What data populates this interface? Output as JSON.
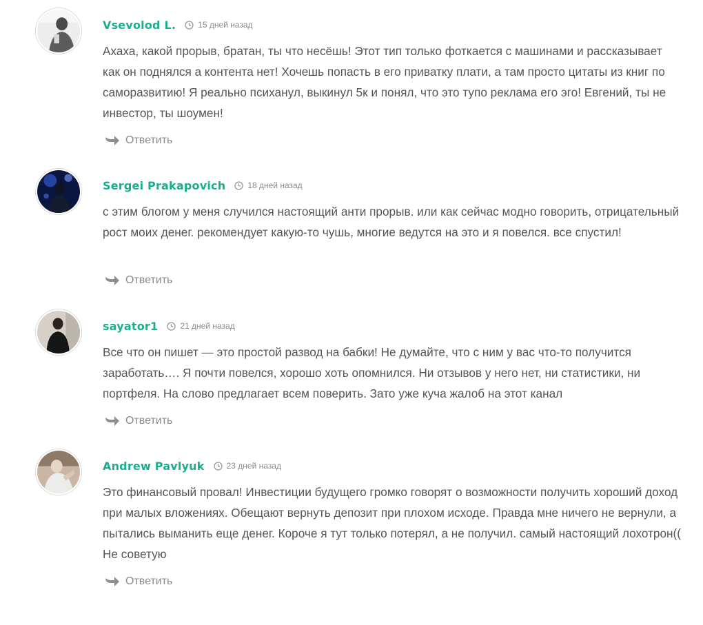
{
  "comments": [
    {
      "author": "Vsevolod L.",
      "time": "15 дней назад",
      "text": "Ахаха, какой прорыв, братан, ты что несёшь! Этот тип только фоткается с машинами и рассказывает как он поднялся а контента нет! Хочешь попасть в его приватку плати, а там просто цитаты из книг по саморазвитию! Я реально психанул, выкинул 5к и понял, что это тупо реклама его эго! Евгений, ты не инвестор, ты шоумен!",
      "reply_label": "Ответить",
      "avatar_colors": [
        "#f2f2f2",
        "#6b6b6b"
      ]
    },
    {
      "author": "Sergei Prakapovich",
      "time": "18 дней назад",
      "text": "с этим блогом у меня случился настоящий анти прорыв. или как сейчас модно говорить, отрицательный рост моих денег. рекомендует какую-то чушь, многие ведутся на это и я повелся. все спустил!",
      "reply_label": "Ответить",
      "avatar_colors": [
        "#0d1a4a",
        "#3a5fd0"
      ]
    },
    {
      "author": "sayator1",
      "time": "21 дней назад",
      "text": "Все что он пишет — это простой развод на бабки! Не думайте, что с ним у вас что-то получится заработать…. Я почти повелся, хорошо хоть опомнился. Ни отзывов у него нет, ни статистики, ни портфеля. На слово предлагает всем поверить. Зато уже куча жалоб на этот канал",
      "reply_label": "Ответить",
      "avatar_colors": [
        "#cfc9c2",
        "#1c1c1c"
      ]
    },
    {
      "author": "Andrew Pavlyuk",
      "time": "23 дней назад",
      "text": "Это финансовый провал! Инвестиции будущего громко говорят о возможности получить хороший доход при малых вложениях. Обещают вернуть депозит при плохом исходе. Правда мне ничего не вернули, а пытались выманить еще денег. Короче я тут только потерял, а не получил. самый настоящий лохотрон(( Не советую",
      "reply_label": "Ответить",
      "avatar_colors": [
        "#b9a18c",
        "#e8e8e4"
      ]
    }
  ],
  "theme": {
    "accent": "#1aae8f",
    "text": "#555555",
    "meta": "#8a8a8a"
  }
}
